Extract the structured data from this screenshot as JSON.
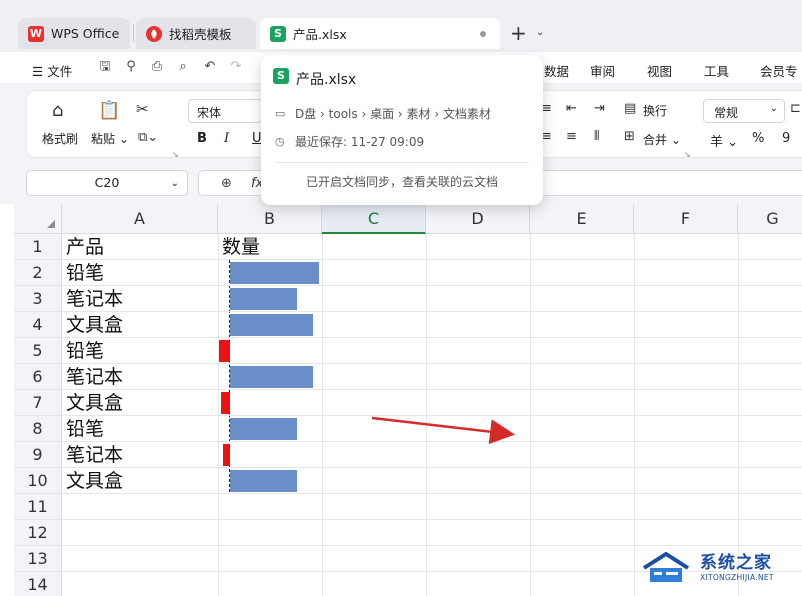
{
  "tabs": [
    {
      "label": "WPS Office",
      "logo": "W",
      "color": "#e8312f"
    },
    {
      "label": "找稻壳模板",
      "logo": "稻",
      "color": "#e8312f"
    },
    {
      "label": "产品.xlsx",
      "logo": "S",
      "color": "#1aa260"
    }
  ],
  "menu": {
    "file": "文件",
    "items": [
      "数据",
      "审阅",
      "视图",
      "工具",
      "会员专"
    ]
  },
  "ribbon": {
    "format_painter": "格式刷",
    "paste": "粘贴",
    "font_name": "宋体",
    "bold": "B",
    "italic": "I",
    "wrap": "换行",
    "merge": "合并",
    "number_format": "常规",
    "currency": "羊",
    "percent": "%",
    "thousands": "9"
  },
  "formula_bar": {
    "cell_ref": "C20",
    "fx": "fx"
  },
  "popup": {
    "title": "产品.xlsx",
    "path": "D盘 › tools › 桌面 › 素材 › 文档素材",
    "last_saved": "最近保存: 11-27 09:09",
    "sync_note": "已开启文档同步，查看关联的云文档"
  },
  "sheet": {
    "columns": [
      "A",
      "B",
      "C",
      "D",
      "E",
      "F",
      "G"
    ],
    "selected_column": "C",
    "rows": [
      "1",
      "2",
      "3",
      "4",
      "5",
      "6",
      "7",
      "8",
      "9",
      "10",
      "11",
      "12",
      "13",
      "14"
    ],
    "header": {
      "product": "产品",
      "quantity": "数量"
    },
    "products": [
      "铅笔",
      "笔记本",
      "文具盒",
      "铅笔",
      "笔记本",
      "文具盒",
      "铅笔",
      "笔记本",
      "文具盒"
    ],
    "data_bars": [
      {
        "value": 1.0,
        "negative": false
      },
      {
        "value": 0.75,
        "negative": false
      },
      {
        "value": 0.93,
        "negative": false
      },
      {
        "value": -0.12,
        "negative": true
      },
      {
        "value": 0.93,
        "negative": false
      },
      {
        "value": -0.1,
        "negative": true
      },
      {
        "value": 0.75,
        "negative": false
      },
      {
        "value": -0.08,
        "negative": true
      },
      {
        "value": 0.75,
        "negative": false
      }
    ],
    "positive_color": "#6a8fc8",
    "negative_color": "#ee1111"
  },
  "watermark": {
    "name": "系统之家",
    "url": "XITONGZHIJIA.NET"
  }
}
